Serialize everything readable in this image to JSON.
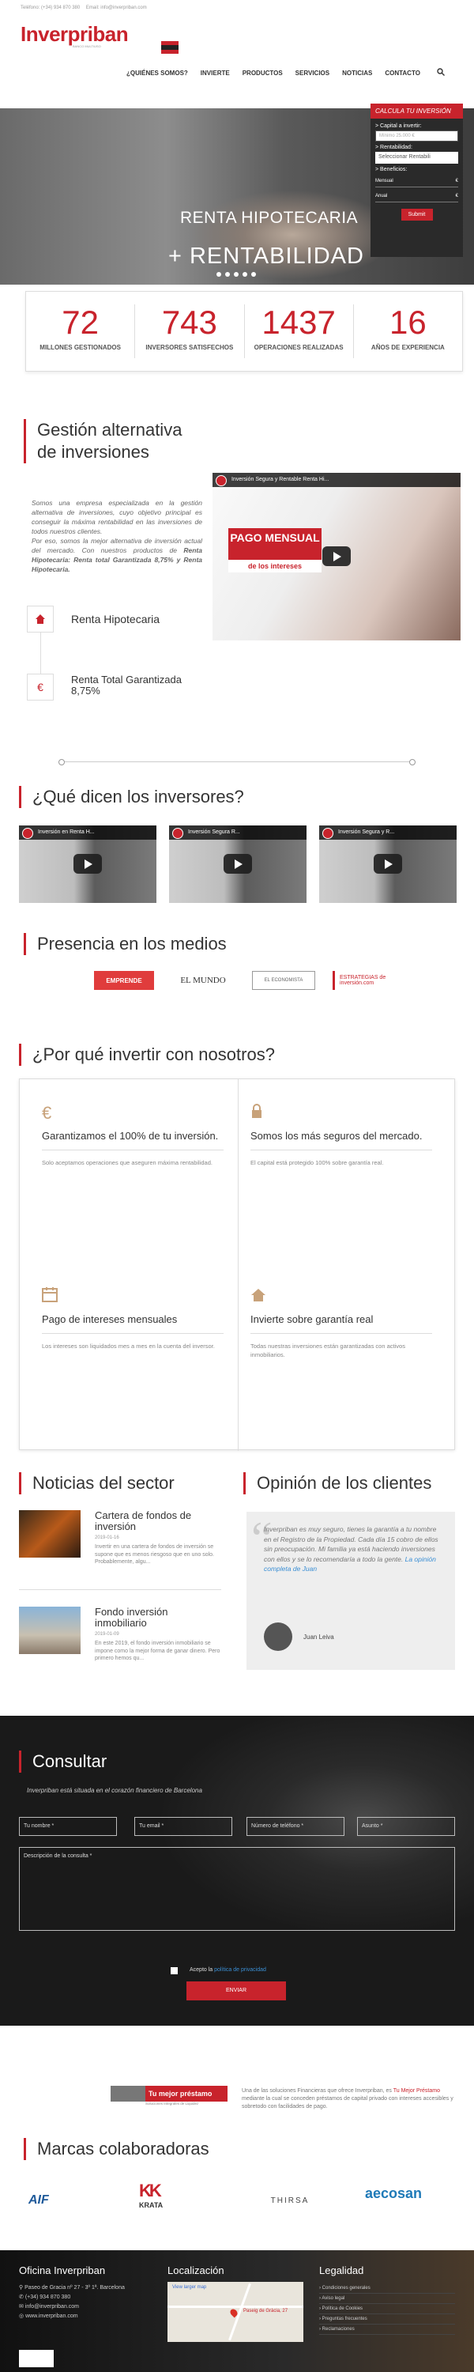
{
  "topbar": {
    "phone_label": "Teléfono: (+34) 934 870 380",
    "email_label": "Email: info@inverpriban.com"
  },
  "logo": {
    "name": "Inverpriban",
    "tagline": "BANCO MULTIUSO"
  },
  "nav": {
    "items": [
      "¿QUIÉNES SOMOS?",
      "INVIERTE",
      "PRODUCTOS",
      "SERVICIOS",
      "NOTICIAS",
      "CONTACTO"
    ]
  },
  "hero": {
    "line1": "RENTA HIPOTECARIA",
    "line2": "+ RENTABILIDAD"
  },
  "calc": {
    "title": "CALCULA TU INVERSIÓN",
    "capital_label": "> Capital a invertir:",
    "capital_placeholder": "Mínimo 25.000 €",
    "rent_label": "> Rentabilidad:",
    "rent_value": "Seleccionar Rentabili",
    "benef_label": "> Beneficios:",
    "mensual_label": "Mensual",
    "anual_label": "Anual",
    "currency": "€",
    "button": "Submit"
  },
  "stats": [
    {
      "num": "72",
      "label": "MILLONES GESTIONADOS"
    },
    {
      "num": "743",
      "label": "INVERSORES SATISFECHOS"
    },
    {
      "num": "1437",
      "label": "OPERACIONES REALIZADAS"
    },
    {
      "num": "16",
      "label": "AÑOS DE EXPERIENCIA"
    }
  ],
  "gestion": {
    "title": "Gestión alternativa de inversiones",
    "text1": "Somos una empresa especializada en la gestión alternativa de inversiones, cuyo objetivo principal es conseguir la máxima rentabilidad en las inversiones de todos nuestros clientes.",
    "text2": "Por eso, somos la mejor alternativa de inversión actual del mercado. Con nuestros productos de ",
    "text2b": "Renta Hipotecaria: Renta total Garantizada 8,75% y Renta Hipotecaria.",
    "video_title": "Inversión Segura y Rentable Renta Hi...",
    "video_banner1": "PAGO MENSUAL",
    "video_banner2": "de los intereses",
    "feature1": "Renta Hipotecaria",
    "feature2a": "Renta Total Garantizada",
    "feature2b": "8,75%"
  },
  "inversores": {
    "title": "¿Qué dicen los inversores?",
    "videos": [
      "Inversión en Renta H...",
      "Inversión Segura R...",
      "Inversión Segura y R..."
    ]
  },
  "medios": {
    "title": "Presencia en los medios",
    "logos": [
      "EMPRENDE",
      "EL MUNDO",
      "EL ECONOMISTA",
      "ESTRATEGIAS de inversión.com"
    ]
  },
  "porque": {
    "title": "¿Por qué invertir con nosotros?",
    "cells": [
      {
        "title": "Garantizamos el 100% de tu inversión.",
        "desc": "Solo aceptamos operaciones que aseguren máxima rentabilidad."
      },
      {
        "title": "Somos los más seguros del mercado.",
        "desc": "El capital está protegido 100% sobre garantía real."
      },
      {
        "title": "Pago de intereses mensuales",
        "desc": "Los intereses son liquidados mes a mes en la cuenta del inversor."
      },
      {
        "title": "Invierte sobre garantía real",
        "desc": "Todas nuestras inversiones están garantizadas con activos inmobiliarios."
      }
    ]
  },
  "noticias": {
    "title": "Noticias del sector",
    "items": [
      {
        "title": "Cartera de fondos de inversión",
        "date": "2019-01-16",
        "text": "Invertir en una cartera de fondos de inversión se supone que es menos riesgoso que en uno solo. Probablemente, algu..."
      },
      {
        "title": "Fondo inversión inmobiliario",
        "date": "2019-01-09",
        "text": "En este 2019, el fondo inversión inmobiliario se impone como la mejor forma de ganar dinero. Pero primero hemos qu..."
      }
    ]
  },
  "opinion": {
    "title": "Opinión de los clientes",
    "quote": "Inverpriban es muy seguro, tienes la garantía a tu nombre en el Registro de la Propiedad. Cada día 15 cobro de ellos sin preocupación. Mi familia ya está haciendo inversiones con ellos y se lo recomendaría a todo la gente. ",
    "link": "La opinión completa de Juan",
    "name": "Juan Leiva"
  },
  "consultar": {
    "title": "Consultar",
    "subtitle": "Inverpriban está situada en el corazón financiero de Barcelona",
    "name": "Tu nombre *",
    "email": "Tu email *",
    "phone": "Número de teléfono *",
    "subject": "Asunto *",
    "desc": "Descripción de la consulta *",
    "accept": "Acepto la ",
    "policy": "política de privacidad",
    "send": "ENVIAR"
  },
  "prestamo": {
    "logo": "Tu mejor préstamo",
    "logo_sub": "Soluciones Integrales de Liquidez",
    "text1": "Una de las soluciones Financieras que ofrece Inverpriban, es ",
    "link": "Tu Mejor Préstamo",
    "text2": " mediante la cual se conceden préstamos de capital privado con intereses accesibles y sobretodo con facilidades de pago."
  },
  "marcas": {
    "title": "Marcas colaboradoras",
    "brands": [
      "AIF",
      "KRATA",
      "THIRSA",
      "aecosan"
    ]
  },
  "footer": {
    "oficina_title": "Oficina Inverpriban",
    "address": "Paseo de Gracia nº 27 - 3º 1ª. Barcelona",
    "phone": "(+34) 934 870 380",
    "email": "info@inverpriban.com",
    "web": "www.inverpriban.com",
    "loc_title": "Localización",
    "map_label": "Paseig de Gràcia, 27",
    "map_link": "View larger map",
    "legal_title": "Legalidad",
    "legal_items": [
      "Condiciones generales",
      "Aviso legal",
      "Política de Cookies",
      "Preguntas frecuentes",
      "Reclamaciones"
    ]
  }
}
